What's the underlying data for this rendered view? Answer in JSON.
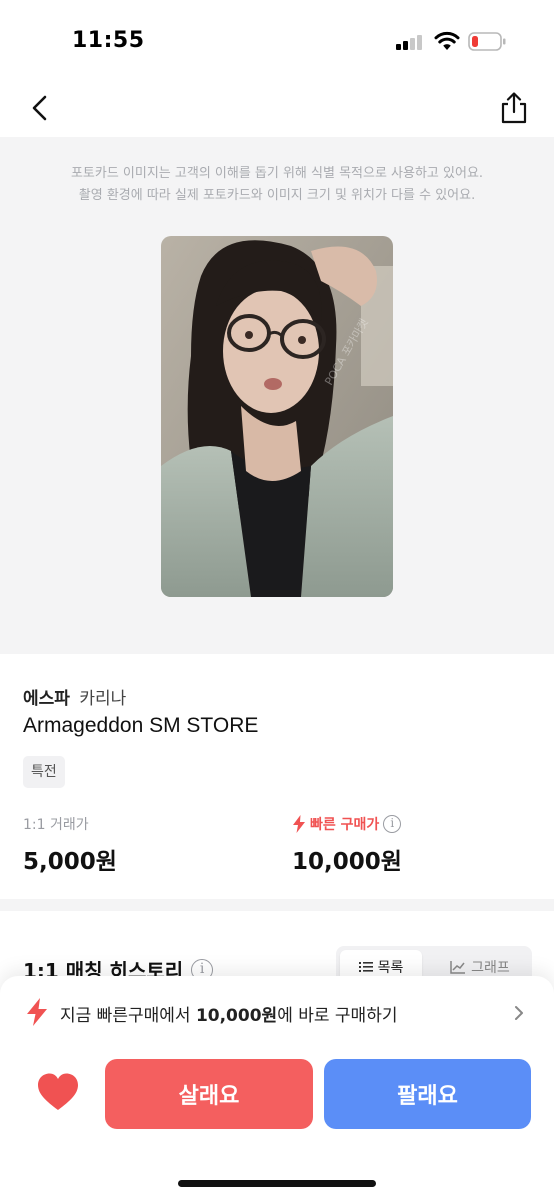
{
  "status_bar": {
    "time": "11:55",
    "signal_icon": "cellular-signal-icon",
    "wifi_icon": "wifi-icon",
    "battery_icon": "battery-low-icon",
    "battery_level": 0.15
  },
  "nav": {
    "back_icon": "chevron-left-icon",
    "share_icon": "share-icon"
  },
  "photo_notice": {
    "line1": "포토카드 이미지는 고객의 이해를 돕기 위해 식별 목적으로 사용하고 있어요.",
    "line2": "촬영 환경에 따라 실제 포토카드와 이미지 크기 및 위치가 다를 수 있어요."
  },
  "photocard": {
    "watermark": "POCA 포카마켓"
  },
  "product": {
    "group": "에스파",
    "member": "카리나",
    "title": "Armageddon SM STORE",
    "tag": "특전"
  },
  "prices": {
    "trade_label": "1:1 거래가",
    "trade_value": "5,000원",
    "fast_label": "빠른 구매가",
    "fast_value": "10,000원",
    "info_glyph": "i"
  },
  "history": {
    "title": "1:1 매칭 히스토리",
    "tabs": [
      {
        "label": "목록",
        "icon": "list-icon",
        "active": true
      },
      {
        "label": "그래프",
        "icon": "line-chart-icon",
        "active": false
      }
    ]
  },
  "bottom": {
    "banner_prefix": "지금 빠른구매에서 ",
    "banner_price": "10,000원",
    "banner_suffix": "에 바로 구매하기",
    "buy_label": "살래요",
    "sell_label": "팔래요"
  },
  "colors": {
    "accent_red": "#f45f5f",
    "accent_blue": "#5b8ef7",
    "fast_red": "#f05252",
    "heart_red": "#f05252"
  }
}
